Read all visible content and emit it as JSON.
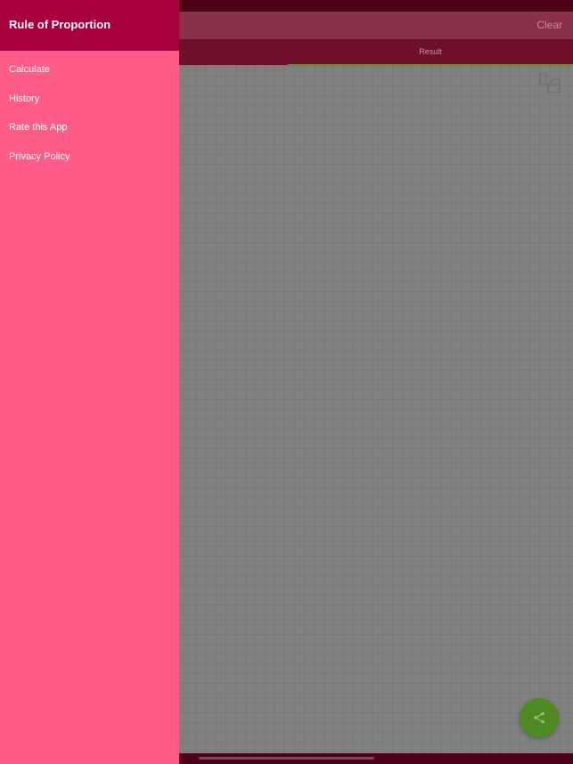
{
  "app_screen": {
    "clear_label": "Clear",
    "tabs": [
      {
        "label": "Result",
        "selected": true
      }
    ],
    "copy_icon": "copy-icon",
    "share_icon": "share-icon"
  },
  "drawer": {
    "title": "Rule of Proportion",
    "items": [
      {
        "label": "Calculate"
      },
      {
        "label": "History"
      },
      {
        "label": "Rate this App"
      },
      {
        "label": "Privacy Policy"
      }
    ]
  },
  "colors": {
    "drawer_background": "#ff5c88",
    "drawer_header": "#a6003d",
    "tab_indicator": "#6a8c2b",
    "fab": "#4e8a22",
    "dim_overlay": "#7f7f7f"
  }
}
